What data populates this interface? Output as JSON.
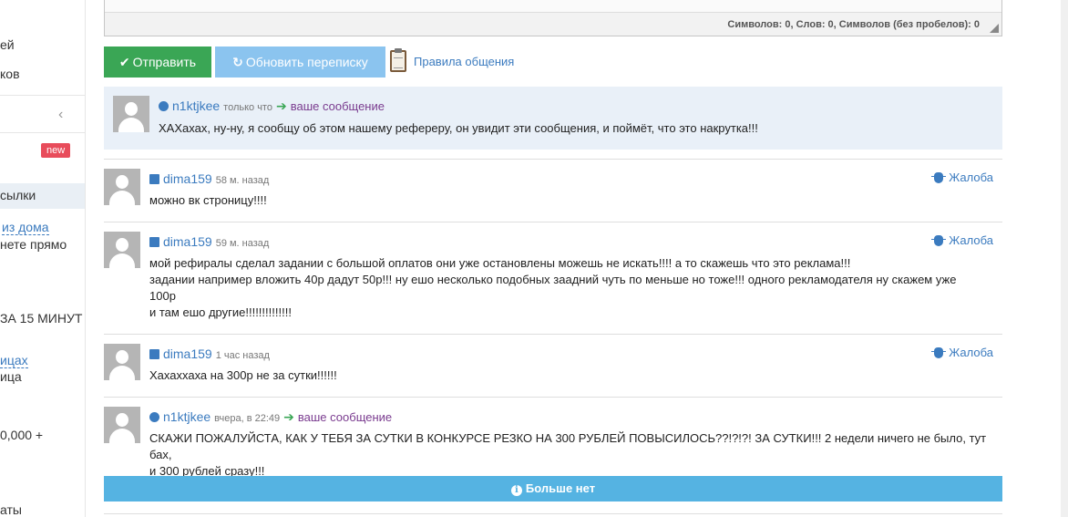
{
  "sidebar": {
    "rows": [
      {
        "text": "ей"
      },
      {
        "text": "ков"
      },
      {
        "text": "сылки"
      },
      {
        "text": "из дома"
      },
      {
        "text": "нете прямо"
      },
      {
        "text": "ЗА 15 МИНУТ"
      },
      {
        "text": "ицах"
      },
      {
        "text": "ица"
      },
      {
        "text": "0,000 +"
      },
      {
        "text": "аты"
      }
    ],
    "new_badge": "new",
    "collapse_icon": "chevron-left-icon"
  },
  "editor": {
    "stats": "Символов: 0, Слов: 0, Символов (без пробелов): 0"
  },
  "toolbar": {
    "send_label": "Отправить",
    "send_icon": "✔",
    "refresh_label": "Обновить переписку",
    "refresh_icon": "↻",
    "rules_label": "Правила общения"
  },
  "messages": [
    {
      "user": "n1ktjkee",
      "time": "только что",
      "to": "ваше сообщение",
      "lines": [
        "ХАХахах, ну-ну, я сообщу об этом нашему рефереру, он увидит эти сообщения, и поймёт, что это накрутка!!!"
      ]
    },
    {
      "user": "dima159",
      "time": "58 м. назад",
      "report": "Жалоба",
      "lines": [
        "можно вк строницу!!!!"
      ]
    },
    {
      "user": "dima159",
      "time": "59 м. назад",
      "report": "Жалоба",
      "lines": [
        "мой рефиралы сделал задании с большой оплатов они уже остановлены можешь не искать!!!! а то скажешь что это реклама!!!",
        "задании например вложить 40р дадут 50р!!! ну ешо несколько подобных заадний чуть по меньше но тоже!!! одного рекламодателя ну скажем уже",
        "100р",
        "и там ешо другие!!!!!!!!!!!!!!"
      ]
    },
    {
      "user": "dima159",
      "time": "1 час назад",
      "report": "Жалоба",
      "lines": [
        "Хахаххаха на 300р не за сутки!!!!!!"
      ]
    },
    {
      "user": "n1ktjkee",
      "time": "вчера, в 22:49",
      "to": "ваше сообщение",
      "lines": [
        "СКАЖИ ПОЖАЛУЙСТА, КАК У ТЕБЯ ЗА СУТКИ В КОНКУРСЕ РЕЗКО НА 300 РУБЛЕЙ ПОВЫСИЛОСЬ??!?!?! ЗА СУТКИ!!! 2 недели ничего не было, тут бах,",
        "и 300 рублей сразу!!!"
      ]
    }
  ],
  "more": {
    "label": "Больше нет",
    "icon": "i"
  },
  "colors": {
    "send": "#3aa655",
    "refresh": "#8bc4ef",
    "link": "#3b7bbf",
    "highlight": "#e9f0f8",
    "more_bar": "#55b3e2",
    "badge": "#e84c5b"
  }
}
